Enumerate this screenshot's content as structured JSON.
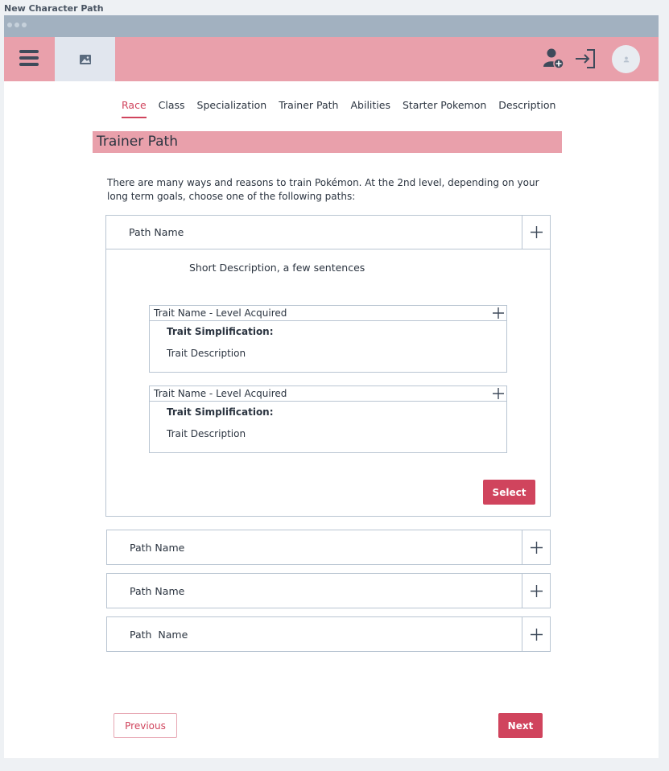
{
  "page_label": "New Character Path",
  "header": {
    "menu_icon": "hamburger-menu-icon",
    "image_icon": "image-placeholder-icon",
    "add_user_icon": "add-user-icon",
    "login_icon": "login-icon",
    "avatar_icon": "user-avatar-icon"
  },
  "tabs": [
    {
      "label": "Race",
      "active": true
    },
    {
      "label": "Class"
    },
    {
      "label": "Specialization"
    },
    {
      "label": "Trainer Path"
    },
    {
      "label": "Abilities"
    },
    {
      "label": "Starter Pokemon"
    },
    {
      "label": "Description"
    }
  ],
  "section_title": "Trainer Path",
  "intro": "There are many ways and reasons to train Pokémon. At the 2nd level, depending on your long term goals, choose one of the following paths:",
  "paths": [
    {
      "name": "Path Name",
      "expanded": true,
      "short_description": "Short Description, a few sentences",
      "traits": [
        {
          "name": "Trait Name - Level Acquired",
          "simplification": "Trait Simplification:",
          "description": "Trait Description"
        },
        {
          "name": "Trait Name - Level Acquired",
          "simplification": "Trait Simplification:",
          "description": "Trait Description"
        }
      ],
      "select_label": "Select"
    },
    {
      "name": "Path Name"
    },
    {
      "name": "Path Name"
    },
    {
      "name": "Path  Name"
    }
  ],
  "nav": {
    "previous_label": "Previous",
    "next_label": "Next"
  },
  "colors": {
    "accent": "#d0445d",
    "appbar": "#e9a0ab",
    "titlebar": "#a2b1c0"
  }
}
